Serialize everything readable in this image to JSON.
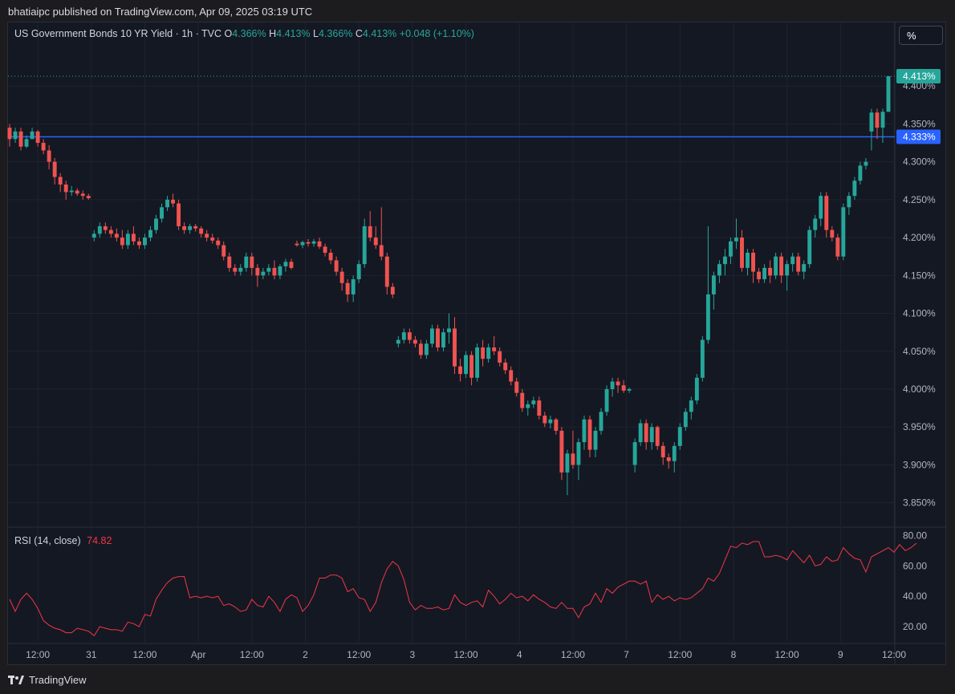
{
  "header": {
    "published": "bhatiaipc published on TradingView.com, Apr 09, 2025 03:19 UTC"
  },
  "legend": {
    "symbol": "US Government Bonds 10 YR Yield · 1h · TVC",
    "o_label": "O",
    "o_value": "4.366%",
    "h_label": "H",
    "h_value": "4.413%",
    "l_label": "L",
    "l_value": "4.366%",
    "c_label": "C",
    "c_value": "4.413%",
    "change": "+0.048 (+1.10%)"
  },
  "unit_button": "%",
  "rsi_legend": {
    "label": "RSI (14, close)",
    "value": "74.82"
  },
  "footer": {
    "brand": "TradingView"
  },
  "colors": {
    "up": "#26a69a",
    "down": "#ef5350",
    "hline": "#2962ff",
    "rsi": "#f23645",
    "bg": "#141823",
    "grid": "#1f2330"
  },
  "chart_data": [
    {
      "type": "candlestick",
      "y_unit": "%",
      "ylim": [
        3.82,
        4.45
      ],
      "y_ticks": [
        "4.400%",
        "4.350%",
        "4.300%",
        "4.250%",
        "4.200%",
        "4.150%",
        "4.100%",
        "4.050%",
        "4.000%",
        "3.950%",
        "3.900%",
        "3.850%"
      ],
      "y_tick_values": [
        4.4,
        4.35,
        4.3,
        4.25,
        4.2,
        4.15,
        4.1,
        4.05,
        4.0,
        3.95,
        3.9,
        3.85
      ],
      "x_ticks": [
        "12:00",
        "31",
        "12:00",
        "Apr",
        "12:00",
        "2",
        "12:00",
        "3",
        "12:00",
        "4",
        "12:00",
        "7",
        "12:00",
        "8",
        "12:00",
        "9",
        "12:00"
      ],
      "x_tick_index": [
        5,
        14.5,
        24,
        33.5,
        43,
        52.5,
        62,
        71.5,
        81,
        90.5,
        100,
        109.5,
        119,
        128.5,
        138,
        147.5,
        157
      ],
      "horizontal_line": {
        "value": 4.333,
        "label": "4.333%"
      },
      "last_price": {
        "value": 4.413,
        "label": "4.413%"
      },
      "candles": [
        [
          4.345,
          4.35,
          4.32,
          4.33
        ],
        [
          4.33,
          4.345,
          4.325,
          4.34
        ],
        [
          4.34,
          4.345,
          4.315,
          4.32
        ],
        [
          4.32,
          4.335,
          4.318,
          4.33
        ],
        [
          4.33,
          4.345,
          4.33,
          4.34
        ],
        [
          4.34,
          4.342,
          4.32,
          4.325
        ],
        [
          4.325,
          4.33,
          4.31,
          4.315
        ],
        [
          4.315,
          4.322,
          4.29,
          4.3
        ],
        [
          4.3,
          4.305,
          4.27,
          4.28
        ],
        [
          4.28,
          4.285,
          4.26,
          4.27
        ],
        [
          4.27,
          4.275,
          4.25,
          4.26
        ],
        [
          4.26,
          4.268,
          4.255,
          4.262
        ],
        [
          4.262,
          4.265,
          4.255,
          4.258
        ],
        [
          4.258,
          4.262,
          4.25,
          4.255
        ],
        [
          4.255,
          4.258,
          4.25,
          4.252
        ],
        [
          4.2,
          4.21,
          4.195,
          4.205
        ],
        [
          4.205,
          4.22,
          4.2,
          4.215
        ],
        [
          4.215,
          4.22,
          4.205,
          4.21
        ],
        [
          4.21,
          4.215,
          4.2,
          4.205
        ],
        [
          4.205,
          4.212,
          4.195,
          4.2
        ],
        [
          4.2,
          4.21,
          4.185,
          4.19
        ],
        [
          4.19,
          4.21,
          4.185,
          4.205
        ],
        [
          4.205,
          4.215,
          4.19,
          4.195
        ],
        [
          4.195,
          4.2,
          4.185,
          4.19
        ],
        [
          4.19,
          4.205,
          4.185,
          4.2
        ],
        [
          4.2,
          4.215,
          4.195,
          4.21
        ],
        [
          4.21,
          4.23,
          4.205,
          4.225
        ],
        [
          4.225,
          4.245,
          4.22,
          4.24
        ],
        [
          4.24,
          4.255,
          4.235,
          4.25
        ],
        [
          4.25,
          4.258,
          4.24,
          4.245
        ],
        [
          4.245,
          4.25,
          4.21,
          4.215
        ],
        [
          4.215,
          4.22,
          4.205,
          4.21
        ],
        [
          4.21,
          4.218,
          4.205,
          4.215
        ],
        [
          4.215,
          4.218,
          4.208,
          4.212
        ],
        [
          4.212,
          4.215,
          4.2,
          4.205
        ],
        [
          4.205,
          4.21,
          4.195,
          4.2
        ],
        [
          4.2,
          4.205,
          4.192,
          4.196
        ],
        [
          4.196,
          4.2,
          4.185,
          4.19
        ],
        [
          4.19,
          4.195,
          4.17,
          4.175
        ],
        [
          4.175,
          4.18,
          4.155,
          4.16
        ],
        [
          4.16,
          4.165,
          4.15,
          4.155
        ],
        [
          4.155,
          4.165,
          4.15,
          4.16
        ],
        [
          4.16,
          4.18,
          4.155,
          4.175
        ],
        [
          4.175,
          4.18,
          4.15,
          4.16
        ],
        [
          4.16,
          4.165,
          4.135,
          4.15
        ],
        [
          4.15,
          4.16,
          4.145,
          4.155
        ],
        [
          4.155,
          4.165,
          4.15,
          4.16
        ],
        [
          4.16,
          4.17,
          4.145,
          4.15
        ],
        [
          4.15,
          4.165,
          4.145,
          4.162
        ],
        [
          4.162,
          4.172,
          4.155,
          4.168
        ],
        [
          4.168,
          4.172,
          4.158,
          4.16
        ],
        [
          4.192,
          4.196,
          4.188,
          4.19
        ],
        [
          4.19,
          4.196,
          4.186,
          4.194
        ],
        [
          4.194,
          4.198,
          4.188,
          4.192
        ],
        [
          4.192,
          4.198,
          4.188,
          4.195
        ],
        [
          4.195,
          4.2,
          4.185,
          4.188
        ],
        [
          4.188,
          4.192,
          4.175,
          4.18
        ],
        [
          4.18,
          4.185,
          4.165,
          4.17
        ],
        [
          4.17,
          4.175,
          4.15,
          4.155
        ],
        [
          4.155,
          4.16,
          4.13,
          4.14
        ],
        [
          4.14,
          4.145,
          4.115,
          4.125
        ],
        [
          4.125,
          4.15,
          4.115,
          4.145
        ],
        [
          4.145,
          4.17,
          4.14,
          4.165
        ],
        [
          4.165,
          4.225,
          4.16,
          4.215
        ],
        [
          4.215,
          4.235,
          4.195,
          4.2
        ],
        [
          4.2,
          4.215,
          4.185,
          4.19
        ],
        [
          4.19,
          4.24,
          4.17,
          4.175
        ],
        [
          4.175,
          4.18,
          4.125,
          4.135
        ],
        [
          4.135,
          4.14,
          4.12,
          4.125
        ],
        [
          4.06,
          4.07,
          4.055,
          4.065
        ],
        [
          4.065,
          4.08,
          4.06,
          4.075
        ],
        [
          4.075,
          4.08,
          4.06,
          4.065
        ],
        [
          4.065,
          4.07,
          4.055,
          4.06
        ],
        [
          4.06,
          4.065,
          4.04,
          4.045
        ],
        [
          4.045,
          4.065,
          4.04,
          4.06
        ],
        [
          4.06,
          4.085,
          4.055,
          4.08
        ],
        [
          4.08,
          4.085,
          4.05,
          4.055
        ],
        [
          4.055,
          4.08,
          4.05,
          4.075
        ],
        [
          4.075,
          4.1,
          4.06,
          4.08
        ],
        [
          4.08,
          4.095,
          4.02,
          4.03
        ],
        [
          4.03,
          4.04,
          4.01,
          4.02
        ],
        [
          4.02,
          4.05,
          4.015,
          4.045
        ],
        [
          4.045,
          4.05,
          4.005,
          4.015
        ],
        [
          4.015,
          4.06,
          4.01,
          4.055
        ],
        [
          4.055,
          4.065,
          4.03,
          4.04
        ],
        [
          4.04,
          4.06,
          4.035,
          4.055
        ],
        [
          4.055,
          4.07,
          4.045,
          4.05
        ],
        [
          4.05,
          4.055,
          4.03,
          4.035
        ],
        [
          4.035,
          4.04,
          4.02,
          4.025
        ],
        [
          4.025,
          4.03,
          4.005,
          4.01
        ],
        [
          4.01,
          4.015,
          3.99,
          3.995
        ],
        [
          3.995,
          4.0,
          3.97,
          3.975
        ],
        [
          3.975,
          3.985,
          3.965,
          3.98
        ],
        [
          3.98,
          3.99,
          3.975,
          3.985
        ],
        [
          3.985,
          3.99,
          3.96,
          3.965
        ],
        [
          3.965,
          3.97,
          3.95,
          3.955
        ],
        [
          3.955,
          3.965,
          3.948,
          3.96
        ],
        [
          3.96,
          3.962,
          3.94,
          3.945
        ],
        [
          3.945,
          3.95,
          3.88,
          3.89
        ],
        [
          3.89,
          3.92,
          3.86,
          3.915
        ],
        [
          3.915,
          3.945,
          3.895,
          3.9
        ],
        [
          3.9,
          3.935,
          3.88,
          3.93
        ],
        [
          3.93,
          3.965,
          3.92,
          3.96
        ],
        [
          3.96,
          3.965,
          3.91,
          3.92
        ],
        [
          3.92,
          3.95,
          3.91,
          3.945
        ],
        [
          3.945,
          3.975,
          3.94,
          3.97
        ],
        [
          3.97,
          4.005,
          3.965,
          4.0
        ],
        [
          4.0,
          4.015,
          3.99,
          4.01
        ],
        [
          4.01,
          4.015,
          3.995,
          4.005
        ],
        [
          4.005,
          4.012,
          3.995,
          3.998
        ],
        [
          3.998,
          4.002,
          3.995,
          4.0
        ],
        [
          3.9,
          3.935,
          3.89,
          3.93
        ],
        [
          3.93,
          3.96,
          3.925,
          3.955
        ],
        [
          3.955,
          3.96,
          3.92,
          3.93
        ],
        [
          3.93,
          3.955,
          3.92,
          3.95
        ],
        [
          3.95,
          3.952,
          3.92,
          3.925
        ],
        [
          3.925,
          3.93,
          3.9,
          3.91
        ],
        [
          3.91,
          3.915,
          3.895,
          3.905
        ],
        [
          3.905,
          3.93,
          3.89,
          3.925
        ],
        [
          3.925,
          3.955,
          3.92,
          3.95
        ],
        [
          3.95,
          3.975,
          3.945,
          3.97
        ],
        [
          3.97,
          3.99,
          3.96,
          3.985
        ],
        [
          3.985,
          4.02,
          3.98,
          4.015
        ],
        [
          4.015,
          4.07,
          4.01,
          4.065
        ],
        [
          4.065,
          4.215,
          4.06,
          4.125
        ],
        [
          4.125,
          4.155,
          4.105,
          4.15
        ],
        [
          4.15,
          4.17,
          4.14,
          4.165
        ],
        [
          4.165,
          4.185,
          4.15,
          4.175
        ],
        [
          4.175,
          4.2,
          4.165,
          4.195
        ],
        [
          4.195,
          4.225,
          4.185,
          4.2
        ],
        [
          4.2,
          4.21,
          4.155,
          4.16
        ],
        [
          4.16,
          4.185,
          4.15,
          4.18
        ],
        [
          4.18,
          4.185,
          4.14,
          4.155
        ],
        [
          4.155,
          4.16,
          4.14,
          4.145
        ],
        [
          4.145,
          4.165,
          4.14,
          4.16
        ],
        [
          4.16,
          4.17,
          4.14,
          4.15
        ],
        [
          4.15,
          4.18,
          4.145,
          4.175
        ],
        [
          4.175,
          4.18,
          4.14,
          4.15
        ],
        [
          4.15,
          4.17,
          4.13,
          4.165
        ],
        [
          4.165,
          4.18,
          4.155,
          4.175
        ],
        [
          4.175,
          4.18,
          4.15,
          4.155
        ],
        [
          4.155,
          4.17,
          4.145,
          4.165
        ],
        [
          4.165,
          4.215,
          4.16,
          4.21
        ],
        [
          4.21,
          4.23,
          4.2,
          4.225
        ],
        [
          4.225,
          4.26,
          4.215,
          4.255
        ],
        [
          4.255,
          4.26,
          4.2,
          4.21
        ],
        [
          4.21,
          4.215,
          4.195,
          4.2
        ],
        [
          4.2,
          4.205,
          4.17,
          4.175
        ],
        [
          4.175,
          4.245,
          4.17,
          4.24
        ],
        [
          4.24,
          4.26,
          4.23,
          4.255
        ],
        [
          4.255,
          4.28,
          4.25,
          4.275
        ],
        [
          4.275,
          4.3,
          4.27,
          4.295
        ],
        [
          4.295,
          4.305,
          4.29,
          4.3
        ],
        [
          4.34,
          4.37,
          4.315,
          4.365
        ],
        [
          4.365,
          4.37,
          4.33,
          4.345
        ],
        [
          4.345,
          4.37,
          4.325,
          4.366
        ],
        [
          4.366,
          4.413,
          4.366,
          4.413
        ]
      ]
    },
    {
      "type": "line",
      "name": "RSI (14, close)",
      "ylim": [
        10,
        85
      ],
      "y_ticks": [
        "80.00",
        "60.00",
        "40.00",
        "20.00"
      ],
      "y_tick_values": [
        80,
        60,
        40,
        20
      ],
      "values": [
        38,
        30,
        38,
        42,
        38,
        32,
        24,
        21,
        19,
        18,
        16,
        16,
        19,
        18,
        17,
        14,
        20,
        19,
        18,
        18,
        17,
        23,
        22,
        20,
        28,
        27,
        38,
        44,
        49,
        52,
        53,
        53,
        39,
        40,
        39,
        40,
        39,
        40,
        34,
        35,
        33,
        30,
        31,
        38,
        34,
        33,
        40,
        36,
        30,
        38,
        41,
        39,
        30,
        34,
        41,
        52,
        52,
        54,
        54,
        52,
        43,
        45,
        39,
        38,
        30,
        36,
        49,
        58,
        63,
        60,
        51,
        36,
        31,
        34,
        32,
        32,
        33,
        31,
        32,
        41,
        36,
        34,
        36,
        37,
        33,
        44,
        40,
        35,
        38,
        42,
        39,
        40,
        37,
        41,
        38,
        36,
        33,
        32,
        36,
        32,
        32,
        26,
        33,
        35,
        42,
        36,
        45,
        42,
        46,
        48,
        50,
        50,
        48,
        50,
        36,
        41,
        38,
        40,
        37,
        39,
        38,
        39,
        42,
        45,
        52,
        50,
        55,
        64,
        73,
        72,
        75,
        74,
        76,
        76,
        66,
        66,
        67,
        66,
        64,
        70,
        66,
        62,
        67,
        60,
        61,
        66,
        63,
        64,
        72,
        68,
        65,
        64,
        56,
        66,
        68,
        70,
        72,
        69,
        74,
        70,
        72,
        75
      ]
    }
  ]
}
